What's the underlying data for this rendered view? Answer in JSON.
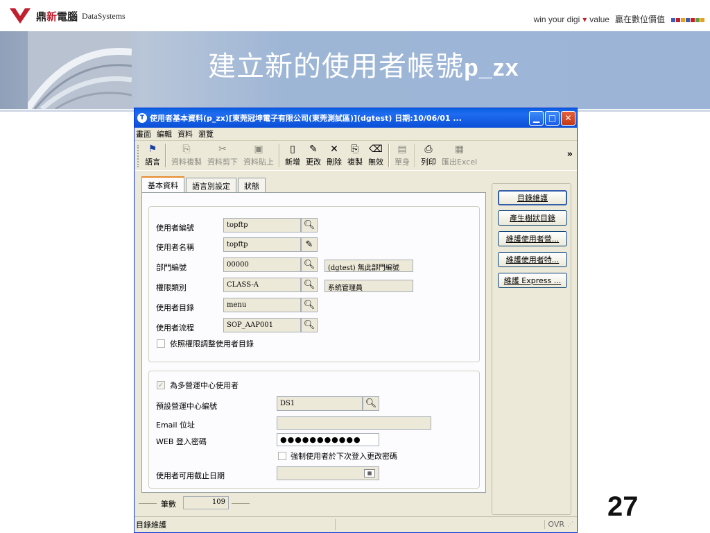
{
  "slide": {
    "logo_cn_a": "鼎",
    "logo_cn_b": "新",
    "logo_cn_c": "電腦",
    "logo_en": "DataSystems",
    "tagline_a": "win your digi",
    "tagline_b": "value",
    "tagline_c": "贏在數位價值",
    "title_cn": "建立新的使用者帳號",
    "title_latin": "p_zx",
    "page_number": "27"
  },
  "window": {
    "title": "使用者基本資料(p_zx)[東莞冠坤電子有限公司(東莞測試區)](dgtest) 日期:10/06/01 ...",
    "menu": [
      "畫面",
      "編輯",
      "資料",
      "瀏覽"
    ],
    "toolbar": [
      {
        "label": "語言",
        "icon": "flag-icon",
        "glyph": "⚑",
        "enabled": true
      },
      {
        "label": "資料複製",
        "icon": "copy-data-icon",
        "glyph": "⎘",
        "enabled": false
      },
      {
        "label": "資料剪下",
        "icon": "cut-icon",
        "glyph": "✂",
        "enabled": false
      },
      {
        "label": "資料貼上",
        "icon": "paste-icon",
        "glyph": "📋",
        "enabled": false
      },
      {
        "label": "新增",
        "icon": "new-file-icon",
        "glyph": "🗋",
        "enabled": true
      },
      {
        "label": "更改",
        "icon": "pencil-icon",
        "glyph": "✎",
        "enabled": true
      },
      {
        "label": "刪除",
        "icon": "delete-x-icon",
        "glyph": "✕",
        "enabled": true
      },
      {
        "label": "複製",
        "icon": "copy-icon",
        "glyph": "⎘",
        "enabled": true
      },
      {
        "label": "無效",
        "icon": "trash-icon",
        "glyph": "🗑",
        "enabled": true
      },
      {
        "label": "單身",
        "icon": "detail-icon",
        "glyph": "▤",
        "enabled": false
      },
      {
        "label": "列印",
        "icon": "printer-icon",
        "glyph": "⎙",
        "enabled": true
      },
      {
        "label": "匯出Excel",
        "icon": "export-excel-icon",
        "glyph": "▦",
        "enabled": false
      }
    ],
    "more": "»",
    "tabs": [
      "基本資料",
      "語言別設定",
      "狀態"
    ],
    "form": {
      "user_id_label": "使用者編號",
      "user_id": "topftp",
      "user_name_label": "使用者名稱",
      "user_name": "topftp",
      "dept_label": "部門編號",
      "dept": "00000",
      "dept_desc": "(dgtest) 無此部門編號",
      "role_label": "權限類別",
      "role": "CLASS-A",
      "role_desc": "系統管理員",
      "menu_label": "使用者目錄",
      "menu_value": "menu",
      "flow_label": "使用者流程",
      "flow": "SOP_AAP001",
      "adjust_label": "依照權限調整使用者目錄",
      "multi_center_label": "為多營運中心使用者",
      "default_center_label": "預設營運中心編號",
      "default_center": "DS1",
      "email_label": "Email 位址",
      "email": "",
      "web_pw_label": "WEB 登入密碼",
      "web_pw": "●●●●●●●●●●●",
      "force_change_label": "強制使用者於下次登入更改密碼",
      "expire_label": "使用者可用截止日期"
    },
    "side_buttons": [
      "目錄維護",
      "產生樹狀目錄",
      "維護使用者營...",
      "維護使用者特...",
      "維護 Express ..."
    ],
    "count_label": "筆數",
    "count_value": "109",
    "status_left": "目錄維護",
    "status_right": "OVR"
  },
  "colors": {
    "title_blue": "#0b4fd6",
    "band": "#9cb4d6",
    "brand_red": "#c0202e"
  }
}
